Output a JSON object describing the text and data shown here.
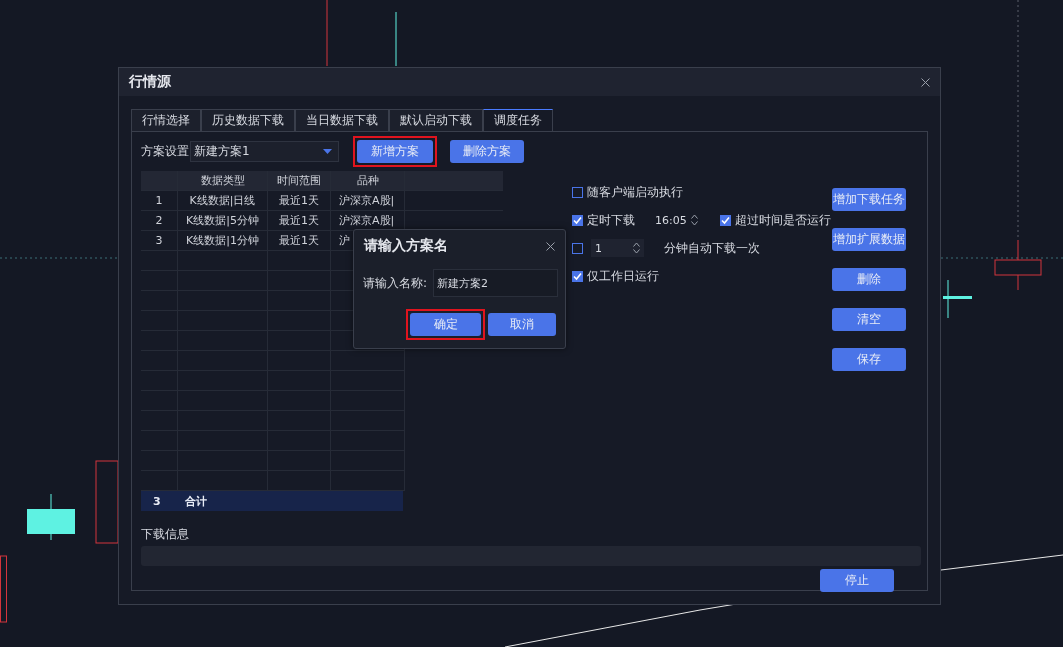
{
  "window": {
    "title": "行情源"
  },
  "tabs": [
    {
      "label": "行情选择",
      "selected": false
    },
    {
      "label": "历史数据下载",
      "selected": false
    },
    {
      "label": "当日数据下载",
      "selected": false
    },
    {
      "label": "默认启动下载",
      "selected": false
    },
    {
      "label": "调度任务",
      "selected": true
    }
  ],
  "scheme": {
    "label": "方案设置",
    "value": "新建方案1"
  },
  "toolbar_buttons": [
    {
      "label": "新增方案",
      "highlighted": true
    },
    {
      "label": "删除方案",
      "highlighted": false
    }
  ],
  "table": {
    "columns": [
      "数据类型",
      "时间范围",
      "品种"
    ],
    "rows": [
      {
        "index": "1",
        "cells": [
          "K线数据|日线",
          "最近1天",
          "沪深京A股|"
        ]
      },
      {
        "index": "2",
        "cells": [
          "K线数据|5分钟",
          "最近1天",
          "沪深京A股|"
        ]
      },
      {
        "index": "3",
        "cells": [
          "K线数据|1分钟",
          "最近1天",
          "沪"
        ]
      }
    ],
    "total": {
      "count": "3",
      "label": "合计"
    }
  },
  "options": {
    "autostart": {
      "label": "随客户端启动执行",
      "checked": false
    },
    "timed": {
      "label": "定时下载",
      "checked": true,
      "time": "16:05"
    },
    "overtime": {
      "label": "超过时间是否运行",
      "checked": true
    },
    "interval": {
      "checked": false,
      "value": "1",
      "label": "分钟自动下载一次"
    },
    "workdays": {
      "label": "仅工作日运行",
      "checked": true
    }
  },
  "side_buttons": [
    "增加下载任务",
    "增加扩展数据",
    "删除",
    "清空",
    "保存"
  ],
  "download_info": {
    "label": "下载信息"
  },
  "stop_button": "停止",
  "prompt": {
    "title": "请输入方案名",
    "field_label": "请输入名称:",
    "value": "新建方案2",
    "buttons": [
      {
        "label": "确定",
        "highlighted": true
      },
      {
        "label": "取消",
        "highlighted": false
      }
    ]
  }
}
